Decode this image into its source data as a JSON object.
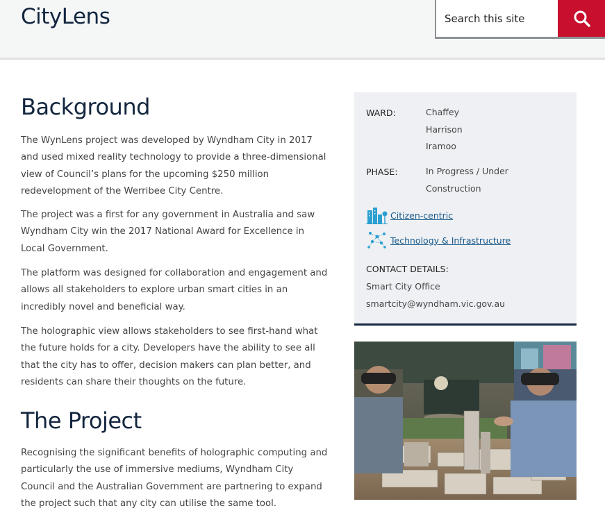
{
  "header": {
    "site_title": "CityLens",
    "search_placeholder": "Search this site"
  },
  "main": {
    "background_heading": "Background",
    "background_paragraphs": [
      "The WynLens project was developed by Wyndham City in 2017 and used mixed reality technology to provide a three-dimensional view of Council’s plans for the upcoming $250 million redevelopment of the Werribee City Centre.",
      "The project was a first for any government in Australia and saw Wyndham City win the 2017 National Award for Excellence in Local Government.",
      "The platform was designed for collaboration and engagement and allows all stakeholders to explore urban smart cities in an incredibly novel and beneficial way.",
      "The holographic view allows stakeholders to see first-hand what the future holds for a city. Developers have the ability to see all that the city has to offer, decision makers can plan better, and residents can share their thoughts on the future."
    ],
    "project_heading": "The Project",
    "project_paragraphs": [
      "Recognising the significant benefits of holographic computing and particularly the use of immersive mediums, Wyndham City Council and the Australian Government are partnering to expand the project such that any city can utilise the same tool."
    ]
  },
  "sidebar": {
    "ward_label": "WARD:",
    "ward_values": [
      "Chaffey",
      "Harrison",
      "Iramoo"
    ],
    "phase_label": "PHASE:",
    "phase_value": "In Progress / Under Construction",
    "tags": [
      {
        "label": "Citizen-centric",
        "icon": "city-buildings-icon"
      },
      {
        "label": "Technology & Infrastructure",
        "icon": "network-nodes-icon"
      }
    ],
    "contact_label": "CONTACT DETAILS:",
    "contact_office": "Smart City Office",
    "contact_email": "smartcity@wyndham.vic.gov.au"
  },
  "colors": {
    "brand_navy": "#13263f",
    "search_red": "#c8102e",
    "link_blue": "#1a5a8a",
    "icon_teal": "#2a9fd0"
  }
}
